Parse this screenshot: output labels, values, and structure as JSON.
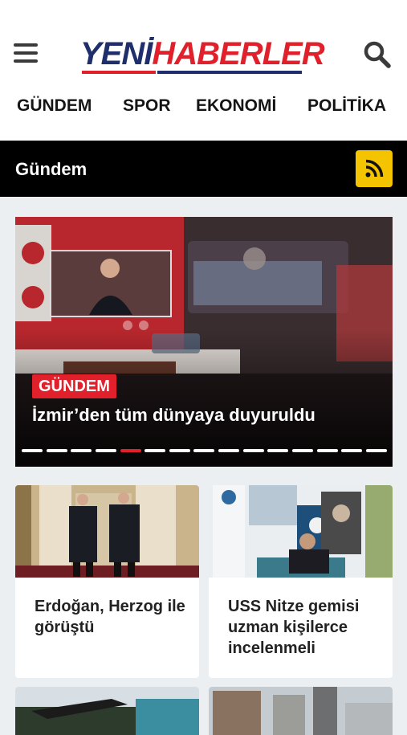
{
  "header": {
    "logo_part1": "YENİ",
    "logo_part2": "HABERLER"
  },
  "nav": {
    "items": [
      "GÜNDEM",
      "SPOR",
      "EKONOMİ",
      "POLİTİKA"
    ]
  },
  "section": {
    "title": "Gündem"
  },
  "slider": {
    "category": "GÜNDEM",
    "title": "İzmir’den tüm dünyaya duyuruldu",
    "dot_count": 15,
    "active_dot": 5
  },
  "cards": [
    {
      "title": "Erdoğan, Herzog ile görüştü"
    },
    {
      "title": "USS Nitze gemisi uzman kişilerce incelenmeli"
    }
  ],
  "colors": {
    "brand_red": "#e0212b",
    "brand_navy": "#1f2f6b",
    "rss_yellow": "#f5c400"
  }
}
